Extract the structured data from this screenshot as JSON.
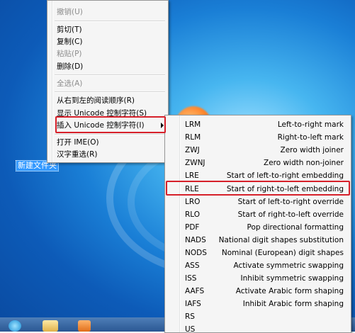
{
  "desktop": {
    "icon_label": "新建文件夹"
  },
  "context_menu": {
    "items": [
      {
        "label": "撤销(U)",
        "enabled": false
      },
      {
        "label": "剪切(T)",
        "enabled": true
      },
      {
        "label": "复制(C)",
        "enabled": true
      },
      {
        "label": "粘贴(P)",
        "enabled": false
      },
      {
        "label": "删除(D)",
        "enabled": true
      },
      {
        "label": "全选(A)",
        "enabled": false
      },
      {
        "label": "从右到左的阅读顺序(R)",
        "enabled": true
      },
      {
        "label": "显示 Unicode 控制字符(S)",
        "enabled": true
      },
      {
        "label": "插入 Unicode 控制字符(I)",
        "enabled": true,
        "has_submenu": true,
        "highlighted": true
      },
      {
        "label": "打开 IME(O)",
        "enabled": true
      },
      {
        "label": "汉字重选(R)",
        "enabled": true
      }
    ]
  },
  "submenu": {
    "items": [
      {
        "code": "LRM",
        "desc": "Left-to-right mark"
      },
      {
        "code": "RLM",
        "desc": "Right-to-left mark"
      },
      {
        "code": "ZWJ",
        "desc": "Zero width joiner"
      },
      {
        "code": "ZWNJ",
        "desc": "Zero width non-joiner"
      },
      {
        "code": "LRE",
        "desc": "Start of left-to-right embedding"
      },
      {
        "code": "RLE",
        "desc": "Start of right-to-left embedding",
        "highlighted": true
      },
      {
        "code": "LRO",
        "desc": "Start of left-to-right override"
      },
      {
        "code": "RLO",
        "desc": "Start of right-to-left override"
      },
      {
        "code": "PDF",
        "desc": "Pop directional formatting"
      },
      {
        "code": "NADS",
        "desc": "National digit shapes substitution"
      },
      {
        "code": "NODS",
        "desc": "Nominal (European) digit shapes"
      },
      {
        "code": "ASS",
        "desc": "Activate symmetric swapping"
      },
      {
        "code": "ISS",
        "desc": "Inhibit symmetric swapping"
      },
      {
        "code": "AAFS",
        "desc": "Activate Arabic form shaping"
      },
      {
        "code": "IAFS",
        "desc": "Inhibit Arabic form shaping"
      },
      {
        "code": "RS",
        "desc": ""
      },
      {
        "code": "US",
        "desc": ""
      }
    ]
  },
  "colors": {
    "highlight_box": "#d6202a",
    "menu_bg": "#f5f5f5"
  }
}
